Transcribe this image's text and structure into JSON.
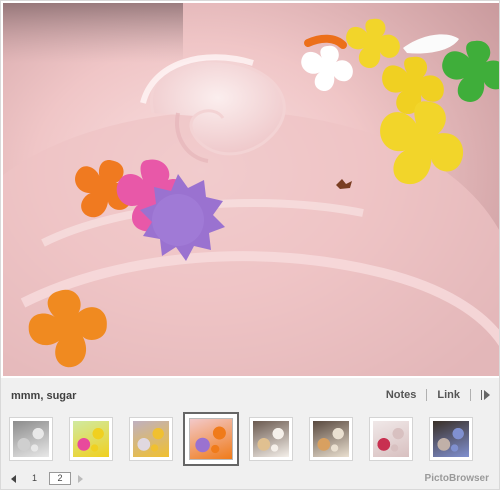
{
  "photo": {
    "caption": "mmm, sugar"
  },
  "actions": {
    "notes_label": "Notes",
    "link_label": "Link",
    "next_icon": "play-next-icon"
  },
  "thumbnails": [
    {
      "icon": "thumbnail-1",
      "colors": [
        "#8c8c8c",
        "#cfcfcf",
        "#e8e8e8"
      ]
    },
    {
      "icon": "thumbnail-2",
      "colors": [
        "#d0eaa0",
        "#e84a9c",
        "#f0d020"
      ]
    },
    {
      "icon": "thumbnail-3",
      "colors": [
        "#bfb0c0",
        "#e0d8e0",
        "#f0c030"
      ]
    },
    {
      "icon": "thumbnail-4",
      "colors": [
        "#f2c9ca",
        "#9a72d0",
        "#f07b1a"
      ]
    },
    {
      "icon": "thumbnail-5",
      "colors": [
        "#6b5a50",
        "#e0c090",
        "#f5f0ea"
      ]
    },
    {
      "icon": "thumbnail-6",
      "colors": [
        "#5a4a40",
        "#d8a060",
        "#eae0d0"
      ]
    },
    {
      "icon": "thumbnail-7",
      "colors": [
        "#f0e8e8",
        "#c83050",
        "#d8c0c0"
      ]
    },
    {
      "icon": "thumbnail-8",
      "colors": [
        "#3a3028",
        "#c0b0a8",
        "#8090d0"
      ]
    }
  ],
  "selected_thumbnail": 4,
  "pager": {
    "page_1": "1",
    "page_2": "2",
    "current_page": 2
  },
  "brand": "PictoBrowser"
}
